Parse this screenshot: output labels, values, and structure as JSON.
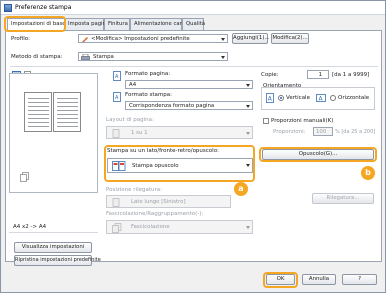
{
  "window": {
    "title": "Preferenze stampa"
  },
  "tabs": [
    {
      "label": "Impostazioni di base"
    },
    {
      "label": "Imposta pagina"
    },
    {
      "label": "Finitura"
    },
    {
      "label": "Alimentazione carta"
    },
    {
      "label": "Qualità"
    }
  ],
  "profile": {
    "label": "Profilo:",
    "value": "<Modifica> Impostazioni predefinite",
    "add_button": "Aggiungi(1)...",
    "edit_button": "Modifica(2)..."
  },
  "output_method": {
    "label": "Metodo di stampa:",
    "value": "Stampa"
  },
  "preview": {
    "caption": "A4 x2 -> A4"
  },
  "left_buttons": {
    "view_settings": "Visualizza impostazioni",
    "restore_defaults": "Ripristina impostazioni predefinite"
  },
  "page_size": {
    "label": "Formato pagina:",
    "value": "A4"
  },
  "output_size": {
    "label": "Formato stampa:",
    "value": "Corrispondenza formato pagina"
  },
  "layout": {
    "label": "Layout di pagina:",
    "value": "1 su 1"
  },
  "print_style": {
    "label": "Stampa su un lato/fronte-retro/opuscolo:",
    "value": "Stampa opuscolo",
    "booklet_button": "Opuscolo(G)..."
  },
  "binding": {
    "label": "Posizione rilegatura:",
    "value": "Lato lungo [Sinistro]",
    "button": "Rilegatura..."
  },
  "finishing": {
    "label": "Fascicolazione/Raggruppamento(-):",
    "value": "Fascicolazione"
  },
  "copies": {
    "label": "Copie:",
    "value": "1",
    "range": "[da 1 a 9999]"
  },
  "orientation": {
    "label": "Orientamento",
    "portrait": "Verticale",
    "landscape": "Orizzontale"
  },
  "manual_scaling": {
    "label": "Proporzioni manuali(K)",
    "scale_label": "Proporzioni:",
    "value": "100",
    "range": "% [da 25 a 200]"
  },
  "callouts": {
    "a": "a",
    "b": "b"
  },
  "footer": {
    "ok": "OK",
    "cancel": "Annulla",
    "help": "?"
  }
}
